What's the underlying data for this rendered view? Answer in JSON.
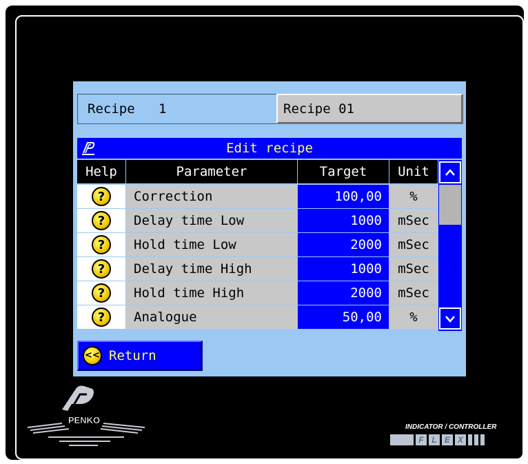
{
  "recipe": {
    "label": "Recipe   1",
    "name": "Recipe 01"
  },
  "title": "Edit recipe",
  "columns": {
    "help": "Help",
    "parameter": "Parameter",
    "target": "Target",
    "unit": "Unit"
  },
  "rows": [
    {
      "help_icon": "?",
      "parameter": "Correction",
      "target": "100,00",
      "unit": "%"
    },
    {
      "help_icon": "?",
      "parameter": "Delay time Low",
      "target": "1000",
      "unit": "mSec"
    },
    {
      "help_icon": "?",
      "parameter": "Hold time Low",
      "target": "2000",
      "unit": "mSec"
    },
    {
      "help_icon": "?",
      "parameter": "Delay time High",
      "target": "1000",
      "unit": "mSec"
    },
    {
      "help_icon": "?",
      "parameter": "Hold time High",
      "target": "2000",
      "unit": "mSec"
    },
    {
      "help_icon": "?",
      "parameter": "Analogue",
      "target": "50,00",
      "unit": "%"
    }
  ],
  "return_button": {
    "icon": "<<",
    "label": "Return"
  },
  "branding": {
    "company": "PENKO",
    "tagline": "INDICATOR / CONTROLLER",
    "product_letters": [
      "F",
      "L",
      "E",
      "X"
    ]
  },
  "colors": {
    "screen": "#9cc9f4",
    "accent_blue": "#0000ff",
    "title_text": "#ffff66"
  },
  "icons": {
    "help": "question-mark-icon",
    "scroll_up": "chevron-up-icon",
    "scroll_down": "chevron-down-icon",
    "return": "double-left-arrow-icon"
  }
}
